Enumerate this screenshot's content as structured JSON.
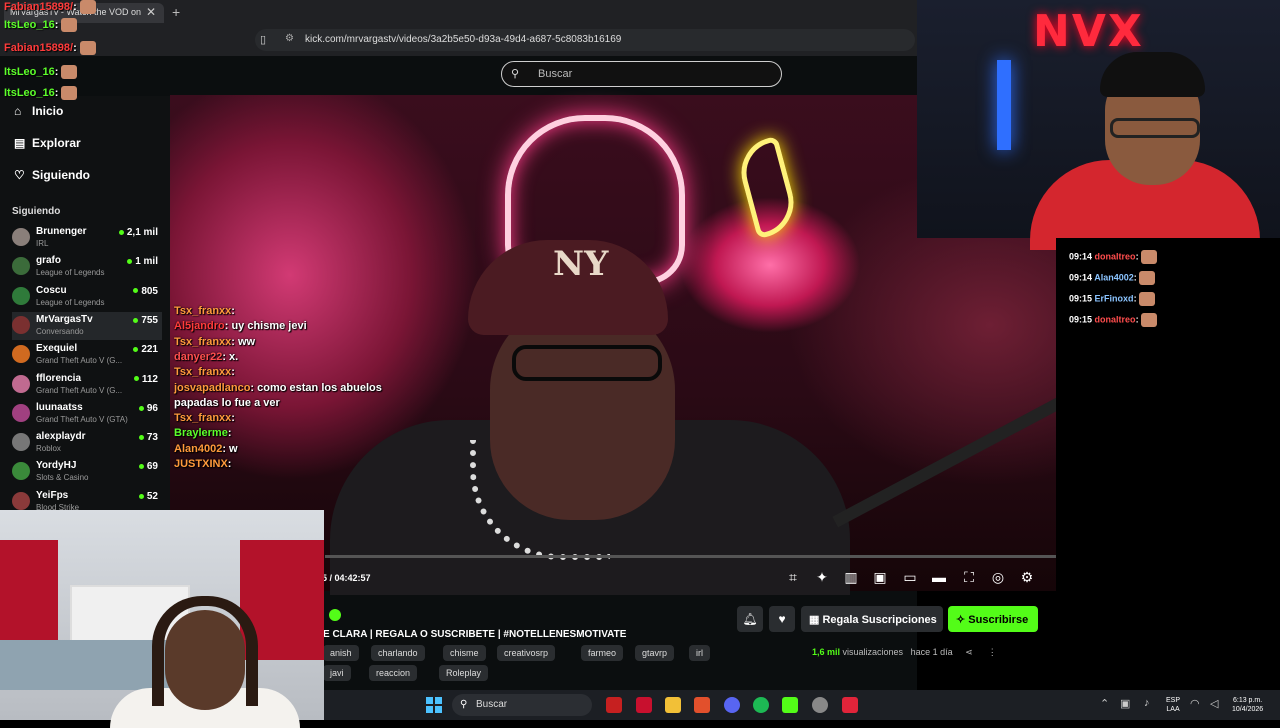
{
  "browser": {
    "tab_title": "MrVargasTv - Watch the VOD on",
    "url": "kick.com/mrvargastv/videos/3a2b5e50-d93a-49d4-a687-5c8083b16169"
  },
  "kick": {
    "search_placeholder": "Buscar",
    "nav": {
      "home": "Inicio",
      "explore": "Explorar",
      "following": "Siguiendo"
    },
    "following_title": "Siguiendo",
    "channels": [
      {
        "name": "Brunenger",
        "game": "IRL",
        "viewers": "2,1 mil",
        "color": "#8a7f7a"
      },
      {
        "name": "grafo",
        "game": "League of Legends",
        "viewers": "1 mil",
        "color": "#3b6b3a"
      },
      {
        "name": "Coscu",
        "game": "League of Legends",
        "viewers": "805",
        "color": "#2f7a3a"
      },
      {
        "name": "MrVargasTv",
        "game": "Conversando",
        "viewers": "755",
        "color": "#7a3030"
      },
      {
        "name": "Exequiel",
        "game": "Grand Theft Auto V (G...",
        "viewers": "221",
        "color": "#d06a20"
      },
      {
        "name": "fflorencia",
        "game": "Grand Theft Auto V (G...",
        "viewers": "112",
        "color": "#c06a90"
      },
      {
        "name": "luunaatss",
        "game": "Grand Theft Auto V (GTA)",
        "viewers": "96",
        "color": "#a04080"
      },
      {
        "name": "alexplaydr",
        "game": "Roblox",
        "viewers": "73",
        "color": "#777"
      },
      {
        "name": "YordyHJ",
        "game": "Slots & Casino",
        "viewers": "69",
        "color": "#3a8a3a"
      },
      {
        "name": "YeiFps",
        "game": "Blood Strike",
        "viewers": "52",
        "color": "#8a3a3a"
      }
    ],
    "time_readout": "5 / 04:42:57",
    "stream_title": "E CLARA | REGALA O SUSCRIBETE | #NOTELLENESMOTIVATE",
    "tags_row1": [
      "anish",
      "charlando",
      "chisme",
      "creativosrp",
      "farmeo",
      "gtavrp",
      "irl"
    ],
    "tags_row2": [
      "javi",
      "reaccion",
      "Roleplay"
    ],
    "gift_label": "Regala Suscripciones",
    "subscribe_label": "Suscribirse",
    "views_count": "1,6 mil",
    "views_label": " visualizaciones",
    "age_label": "hace 1 día",
    "cap_logo": "NY"
  },
  "overlay_chat_left": [
    {
      "user": "Tsx_franxx",
      "msg": ":",
      "color": "#ff9a3c"
    },
    {
      "user": "Al5jandro",
      "msg": ": uy chisme jevi",
      "color": "#ff3b3b"
    },
    {
      "user": "Tsx_franxx",
      "msg": ": ww",
      "color": "#ff9a3c"
    },
    {
      "user": "danyer22",
      "msg": ": x.",
      "color": "#ff4f4f"
    },
    {
      "user": "Tsx_franxx",
      "msg": ":",
      "color": "#ff9a3c"
    },
    {
      "user": "josvapadlanco",
      "msg": ": como estan los abuelos",
      "color": "#ff9a3c"
    },
    {
      "user": "",
      "msg": "papadas lo fue a ver",
      "color": "#ffffff"
    },
    {
      "user": "Tsx_franxx",
      "msg": ":",
      "color": "#ff9a3c"
    },
    {
      "user": "Braylerme",
      "msg": ":",
      "color": "#5dff2b"
    },
    {
      "user": "Alan4002",
      "msg": ": w",
      "color": "#ff9a3c"
    },
    {
      "user": "JUSTXINX",
      "msg": ":",
      "color": "#ff9a3c"
    }
  ],
  "top_left_chat": [
    {
      "user": "Fabian15898/",
      "msg": ":",
      "color": "#ff3b3b"
    },
    {
      "user": "ItsLeo_16",
      "msg": ":",
      "color": "#5dff2b"
    },
    {
      "user": "Fabian15898/",
      "msg": ":",
      "color": "#ff3b3b"
    },
    {
      "user": "ItsLeo_16",
      "msg": ":",
      "color": "#5dff2b"
    },
    {
      "user": "ItsLeo_16",
      "msg": ":",
      "color": "#5dff2b"
    }
  ],
  "right_chat": [
    {
      "time": "09:14",
      "user": "donaltreo",
      "color": "#ff4d4d"
    },
    {
      "time": "09:14",
      "user": "Alan4002",
      "color": "#8bc4ff"
    },
    {
      "time": "09:15",
      "user": "ErFinoxd",
      "color": "#8bc4ff"
    },
    {
      "time": "09:15",
      "user": "donaltreo",
      "color": "#ff4d4d"
    }
  ],
  "facecam_sign": "NVX",
  "taskbar": {
    "search_placeholder": "Buscar",
    "lang_top": "ESP",
    "lang_bottom": "LAA",
    "time": "6:13 p.m.",
    "date": "10/4/2026"
  }
}
